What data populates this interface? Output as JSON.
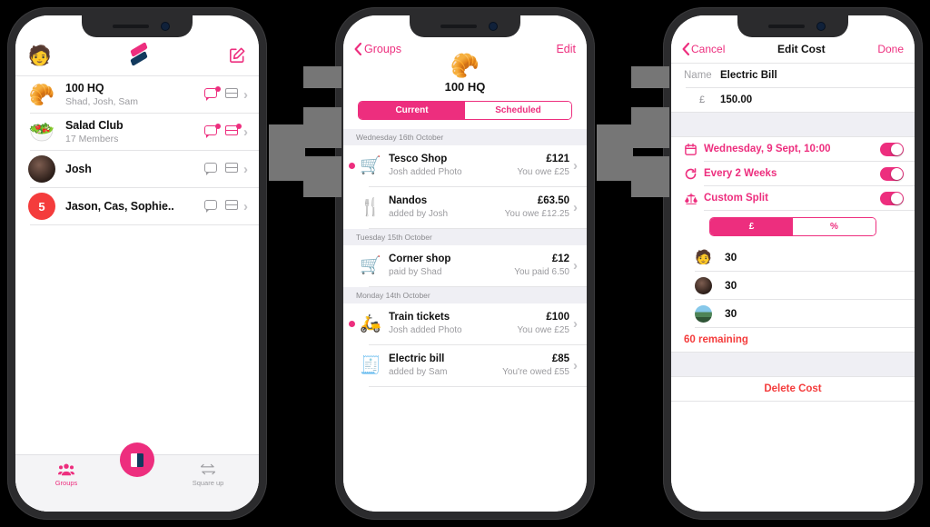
{
  "colors": {
    "accent": "#ED2E7E",
    "navy": "#123A5E",
    "red": "#F43C3C",
    "gray_button": "#767676"
  },
  "phone1": {
    "header": {
      "avatar_icon": "person-avatar",
      "logo_icon": "app-logo",
      "compose_icon": "compose-icon"
    },
    "groups": [
      {
        "icon": "croissant-emoji",
        "emoji": "🥐",
        "name": "100 HQ",
        "sub": "Shad, Josh, Sam",
        "chat_badge": true,
        "card_badge": false,
        "chat_active": true,
        "card_active": false,
        "avatar_kind": "emoji"
      },
      {
        "icon": "salad-emoji",
        "emoji": "🥗",
        "name": "Salad Club",
        "sub": "17 Members",
        "chat_badge": true,
        "card_badge": true,
        "chat_active": true,
        "card_active": true,
        "avatar_kind": "emoji"
      },
      {
        "icon": "photo-avatar",
        "emoji": "",
        "name": "Josh",
        "sub": "",
        "chat_badge": false,
        "card_badge": false,
        "chat_active": false,
        "card_active": false,
        "avatar_kind": "photo"
      },
      {
        "icon": "count-badge",
        "emoji": "5",
        "name": "Jason, Cas, Sophie..",
        "sub": "",
        "chat_badge": false,
        "card_badge": false,
        "chat_active": false,
        "card_active": false,
        "avatar_kind": "count"
      }
    ],
    "fab": {
      "icon": "add-cost-icon"
    },
    "tabs": [
      {
        "label": "Groups",
        "icon": "groups-icon",
        "active": true
      },
      {
        "label": "Square up",
        "icon": "square-up-icon",
        "active": false
      }
    ]
  },
  "phone2": {
    "nav": {
      "back_label": "Groups",
      "back_icon": "chevron-left-icon",
      "edit_label": "Edit"
    },
    "group": {
      "emoji": "🥐",
      "emoji_icon": "croissant-emoji",
      "name": "100 HQ"
    },
    "segments": [
      {
        "label": "Current",
        "selected": true
      },
      {
        "label": "Scheduled",
        "selected": false
      }
    ],
    "sections": [
      {
        "date": "Wednesday 16th October",
        "items": [
          {
            "unread": true,
            "icon": "shopping-trolley-icon",
            "emoji": "🛒",
            "name": "Tesco Shop",
            "sub": "Josh added Photo",
            "amount": "£121",
            "status": "You owe £25"
          },
          {
            "unread": false,
            "icon": "cutlery-icon",
            "emoji": "🍴",
            "name": "Nandos",
            "sub": "added by Josh",
            "amount": "£63.50",
            "status": "You owe £12.25"
          }
        ]
      },
      {
        "date": "Tuesday 15th October",
        "items": [
          {
            "unread": false,
            "icon": "shopping-trolley-icon",
            "emoji": "🛒",
            "name": "Corner shop",
            "sub": "paid by Shad",
            "amount": "£12",
            "status": "You paid 6.50"
          }
        ]
      },
      {
        "date": "Monday 14th October",
        "items": [
          {
            "unread": true,
            "icon": "scooter-icon",
            "emoji": "🛵",
            "name": "Train tickets",
            "sub": "Josh added Photo",
            "amount": "£100",
            "status": "You owe £25"
          },
          {
            "unread": false,
            "icon": "document-icon",
            "emoji": "🧾",
            "name": "Electric bill",
            "sub": "added by Sam",
            "amount": "£85",
            "status": "You're owed £55"
          }
        ]
      }
    ]
  },
  "phone3": {
    "nav": {
      "cancel_label": "Cancel",
      "back_icon": "chevron-left-icon",
      "title": "Edit Cost",
      "done_label": "Done"
    },
    "name_field": {
      "label": "Name",
      "value": "Electric Bill"
    },
    "amount_field": {
      "currency": "£",
      "value": "150.00"
    },
    "toggles": [
      {
        "icon": "calendar-icon",
        "label": "Wednesday, 9  Sept, 10:00",
        "on": true
      },
      {
        "icon": "repeat-icon",
        "label": "Every 2 Weeks",
        "on": true
      },
      {
        "icon": "scales-icon",
        "label": "Custom Split",
        "on": true
      }
    ],
    "split_segments": [
      {
        "label": "£",
        "selected": true
      },
      {
        "label": "%",
        "selected": false
      }
    ],
    "participants": [
      {
        "avatar_kind": "emoji",
        "emoji": "🧑",
        "icon": "person-avatar",
        "value": "30"
      },
      {
        "avatar_kind": "photo",
        "emoji": "",
        "icon": "photo-avatar",
        "value": "30"
      },
      {
        "avatar_kind": "land",
        "emoji": "",
        "icon": "landscape-avatar",
        "value": "30"
      }
    ],
    "remaining_label": "60 remaining",
    "delete_label": "Delete Cost"
  }
}
